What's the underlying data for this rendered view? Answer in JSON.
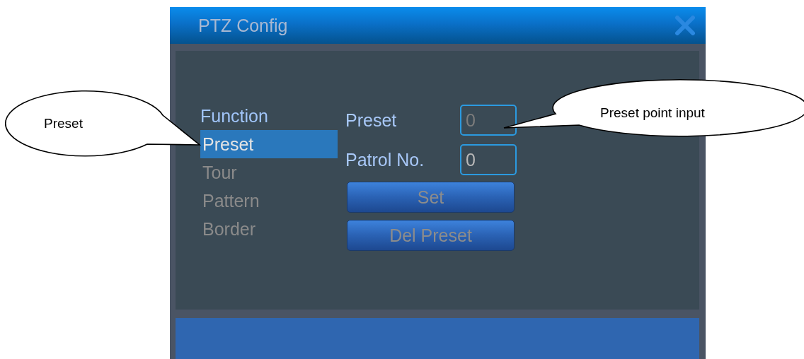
{
  "window": {
    "title": "PTZ Config"
  },
  "menu": {
    "heading": "Function",
    "items": [
      {
        "label": "Preset",
        "selected": true
      },
      {
        "label": "Tour",
        "selected": false
      },
      {
        "label": "Pattern",
        "selected": false
      },
      {
        "label": "Border",
        "selected": false
      }
    ]
  },
  "fields": [
    {
      "label": "Preset",
      "value": "0",
      "disabled": true
    },
    {
      "label": "Patrol No.",
      "value": "0",
      "disabled": false
    }
  ],
  "buttons": [
    "Set",
    "Del Preset"
  ],
  "callouts": [
    {
      "text": "Preset"
    },
    {
      "text": "Preset point input"
    }
  ]
}
